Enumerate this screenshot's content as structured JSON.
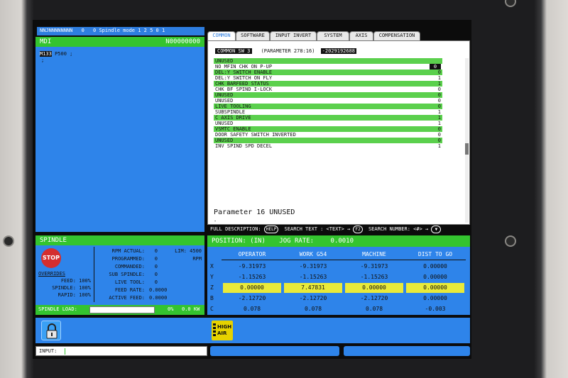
{
  "topbar": {
    "prog": "NNJNNNNNNNN",
    "count": "0",
    "spindle_mode": "0 Spindle mode 1 2 5 0 1"
  },
  "mdi": {
    "title": "MDI",
    "prog_no": "N00000000",
    "line1_cmd": "M133",
    "line1_rest": " P500 ;",
    "line2": ";"
  },
  "tabs": [
    {
      "label": "COMMON"
    },
    {
      "label": "SOFTWARE"
    },
    {
      "label": "INPUT INVERT"
    },
    {
      "label": "SYSTEM"
    },
    {
      "label": "AXIS"
    },
    {
      "label": "COMPENSATION"
    }
  ],
  "param_head": {
    "name": "COMMON SW 3",
    "param": "(PARAMETER  278:16)",
    "value": "-2029192688"
  },
  "params": [
    {
      "label": "UNUSED",
      "value": ""
    },
    {
      "label": "NO MFIN CHK ON P-UP",
      "value": "0"
    },
    {
      "label": "DEL:Y SWITCH ENABLE",
      "value": "0"
    },
    {
      "label": "DEL:Y SWITCH ON FLY",
      "value": "1"
    },
    {
      "label": "CHK BARFEED STATUS",
      "value": "1"
    },
    {
      "label": "CHK BF SPIND I-LOCK",
      "value": "0"
    },
    {
      "label": "UNUSED",
      "value": "0"
    },
    {
      "label": "UNUSED",
      "value": "0"
    },
    {
      "label": "LIVE TOOLING",
      "value": "0"
    },
    {
      "label": "SUBSPINDLE",
      "value": "1"
    },
    {
      "label": "C AXIS DRIVE",
      "value": "1"
    },
    {
      "label": "UNUSED",
      "value": "1"
    },
    {
      "label": "VSMTC ENABLE",
      "value": "0"
    },
    {
      "label": "DOOR SAFETY SWITCH INVERTED",
      "value": "0"
    },
    {
      "label": "UNUSED",
      "value": "0"
    },
    {
      "label": "INV SPIND SPD DECEL",
      "value": "1"
    }
  ],
  "param_desc": "Parameter 16 UNUSED",
  "param_desc2": "-",
  "help_bar": {
    "full_desc": "FULL DESCRIPTION:",
    "help_key": "HELP",
    "search_text": "SEARCH TEXT : <TEXT> →",
    "f2_key": "F2",
    "search_number": "SEARCH NUMBER: <#> →"
  },
  "spindle": {
    "title": "SPINDLE",
    "stop_label": "STOP",
    "overrides_title": "OVERRIDES",
    "feed": "FEED: 100%",
    "spindle": "SPINDLE: 100%",
    "rapid": "RAPID: 100%",
    "rows": [
      {
        "label": "RPM ACTUAL:",
        "value": "0",
        "extra": "LIM: 4500"
      },
      {
        "label": "PROGRAMMED:",
        "value": "0",
        "extra": "RPM"
      },
      {
        "label": "COMMANDED:",
        "value": "0",
        "extra": ""
      },
      {
        "label": "SUB SPINDLE:",
        "value": "0",
        "extra": ""
      },
      {
        "label": "LIVE TOOL:",
        "value": "0",
        "extra": ""
      },
      {
        "label": "FEED RATE:",
        "value": "0.0000",
        "extra": ""
      },
      {
        "label": "ACTIVE FEED:",
        "value": "0.0000",
        "extra": ""
      }
    ],
    "load_label": "SPINDLE LOAD:",
    "load_pct": "0%",
    "load_kw": "0.0 KW",
    "load_fraction": 0
  },
  "position": {
    "title": "POSITION: (IN)",
    "jog_label": "JOG RATE:",
    "jog_value": "0.0010",
    "columns": [
      "OPERATOR",
      "WORK G54",
      "MACHINE",
      "DIST TO GO"
    ],
    "rows": [
      {
        "axis": "X",
        "values": [
          "-9.31973",
          "-9.31973",
          "-9.31973",
          "0.00000"
        ]
      },
      {
        "axis": "Y",
        "values": [
          "-1.15263",
          "-1.15263",
          "-1.15263",
          "0.00000"
        ]
      },
      {
        "axis": "Z",
        "values": [
          "0.00000",
          "7.47831",
          "0.00000",
          "0.00000"
        ]
      },
      {
        "axis": "B",
        "values": [
          "-2.12720",
          "-2.12720",
          "-2.12720",
          "0.00000"
        ]
      },
      {
        "axis": "C",
        "values": [
          "0.078",
          "0.078",
          "0.078",
          "-0.003"
        ]
      }
    ]
  },
  "status": {
    "high_air_1": "HIGH",
    "high_air_2": "AIR"
  },
  "input": {
    "label": "INPUT:",
    "value": ""
  },
  "colors": {
    "panel_blue": "#2e84ea",
    "header_green": "#34c42f",
    "row_green": "#5bd04d",
    "highlight_yellow": "#e9ea3a"
  },
  "icons": [
    "lock-icon",
    "stop-icon",
    "high-air-icon",
    "help-key-icon",
    "down-arrow-key-icon"
  ]
}
